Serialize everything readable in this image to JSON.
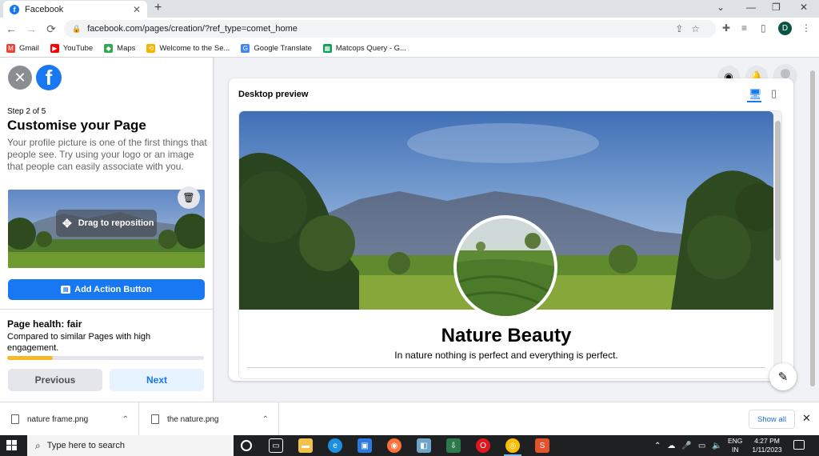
{
  "browser": {
    "tab_title": "Facebook",
    "url": "facebook.com/pages/creation/?ref_type=comet_home",
    "profile_initial": "D",
    "bookmarks": [
      {
        "label": "Gmail",
        "color": "#ea4335",
        "glyph": "M"
      },
      {
        "label": "YouTube",
        "color": "#ff0000",
        "glyph": "▶"
      },
      {
        "label": "Maps",
        "color": "#34a853",
        "glyph": "◆"
      },
      {
        "label": "Welcome to the Se...",
        "color": "#f4b400",
        "glyph": "⟲"
      },
      {
        "label": "Google Translate",
        "color": "#4285f4",
        "glyph": "G"
      },
      {
        "label": "Matcops Query - G...",
        "color": "#0f9d58",
        "glyph": "▦"
      }
    ]
  },
  "sidebar": {
    "step": "Step 2 of 5",
    "title": "Customise your Page",
    "description": "Your profile picture is one of the first things that people see. Try using your logo or an image that people can easily associate with you.",
    "drag_hint": "Drag to reposition",
    "action_button": "Add Action Button",
    "health_title": "Page health: fair",
    "health_desc": "Compared to similar Pages with high engagement.",
    "health_progress": 0.23,
    "prev_label": "Previous",
    "next_label": "Next"
  },
  "preview": {
    "label": "Desktop preview",
    "page_name": "Nature Beauty",
    "page_bio": "In nature nothing is perfect and everything is perfect."
  },
  "downloads": {
    "items": [
      "nature frame.png",
      "the nature.png"
    ],
    "show_all": "Show all"
  },
  "taskbar": {
    "search_placeholder": "Type here to search",
    "time": "4:27 PM",
    "date": "1/11/2023",
    "lang": "ENG",
    "region": "IN"
  },
  "colors": {
    "accent": "#1877f2",
    "health": "#f7b928"
  }
}
